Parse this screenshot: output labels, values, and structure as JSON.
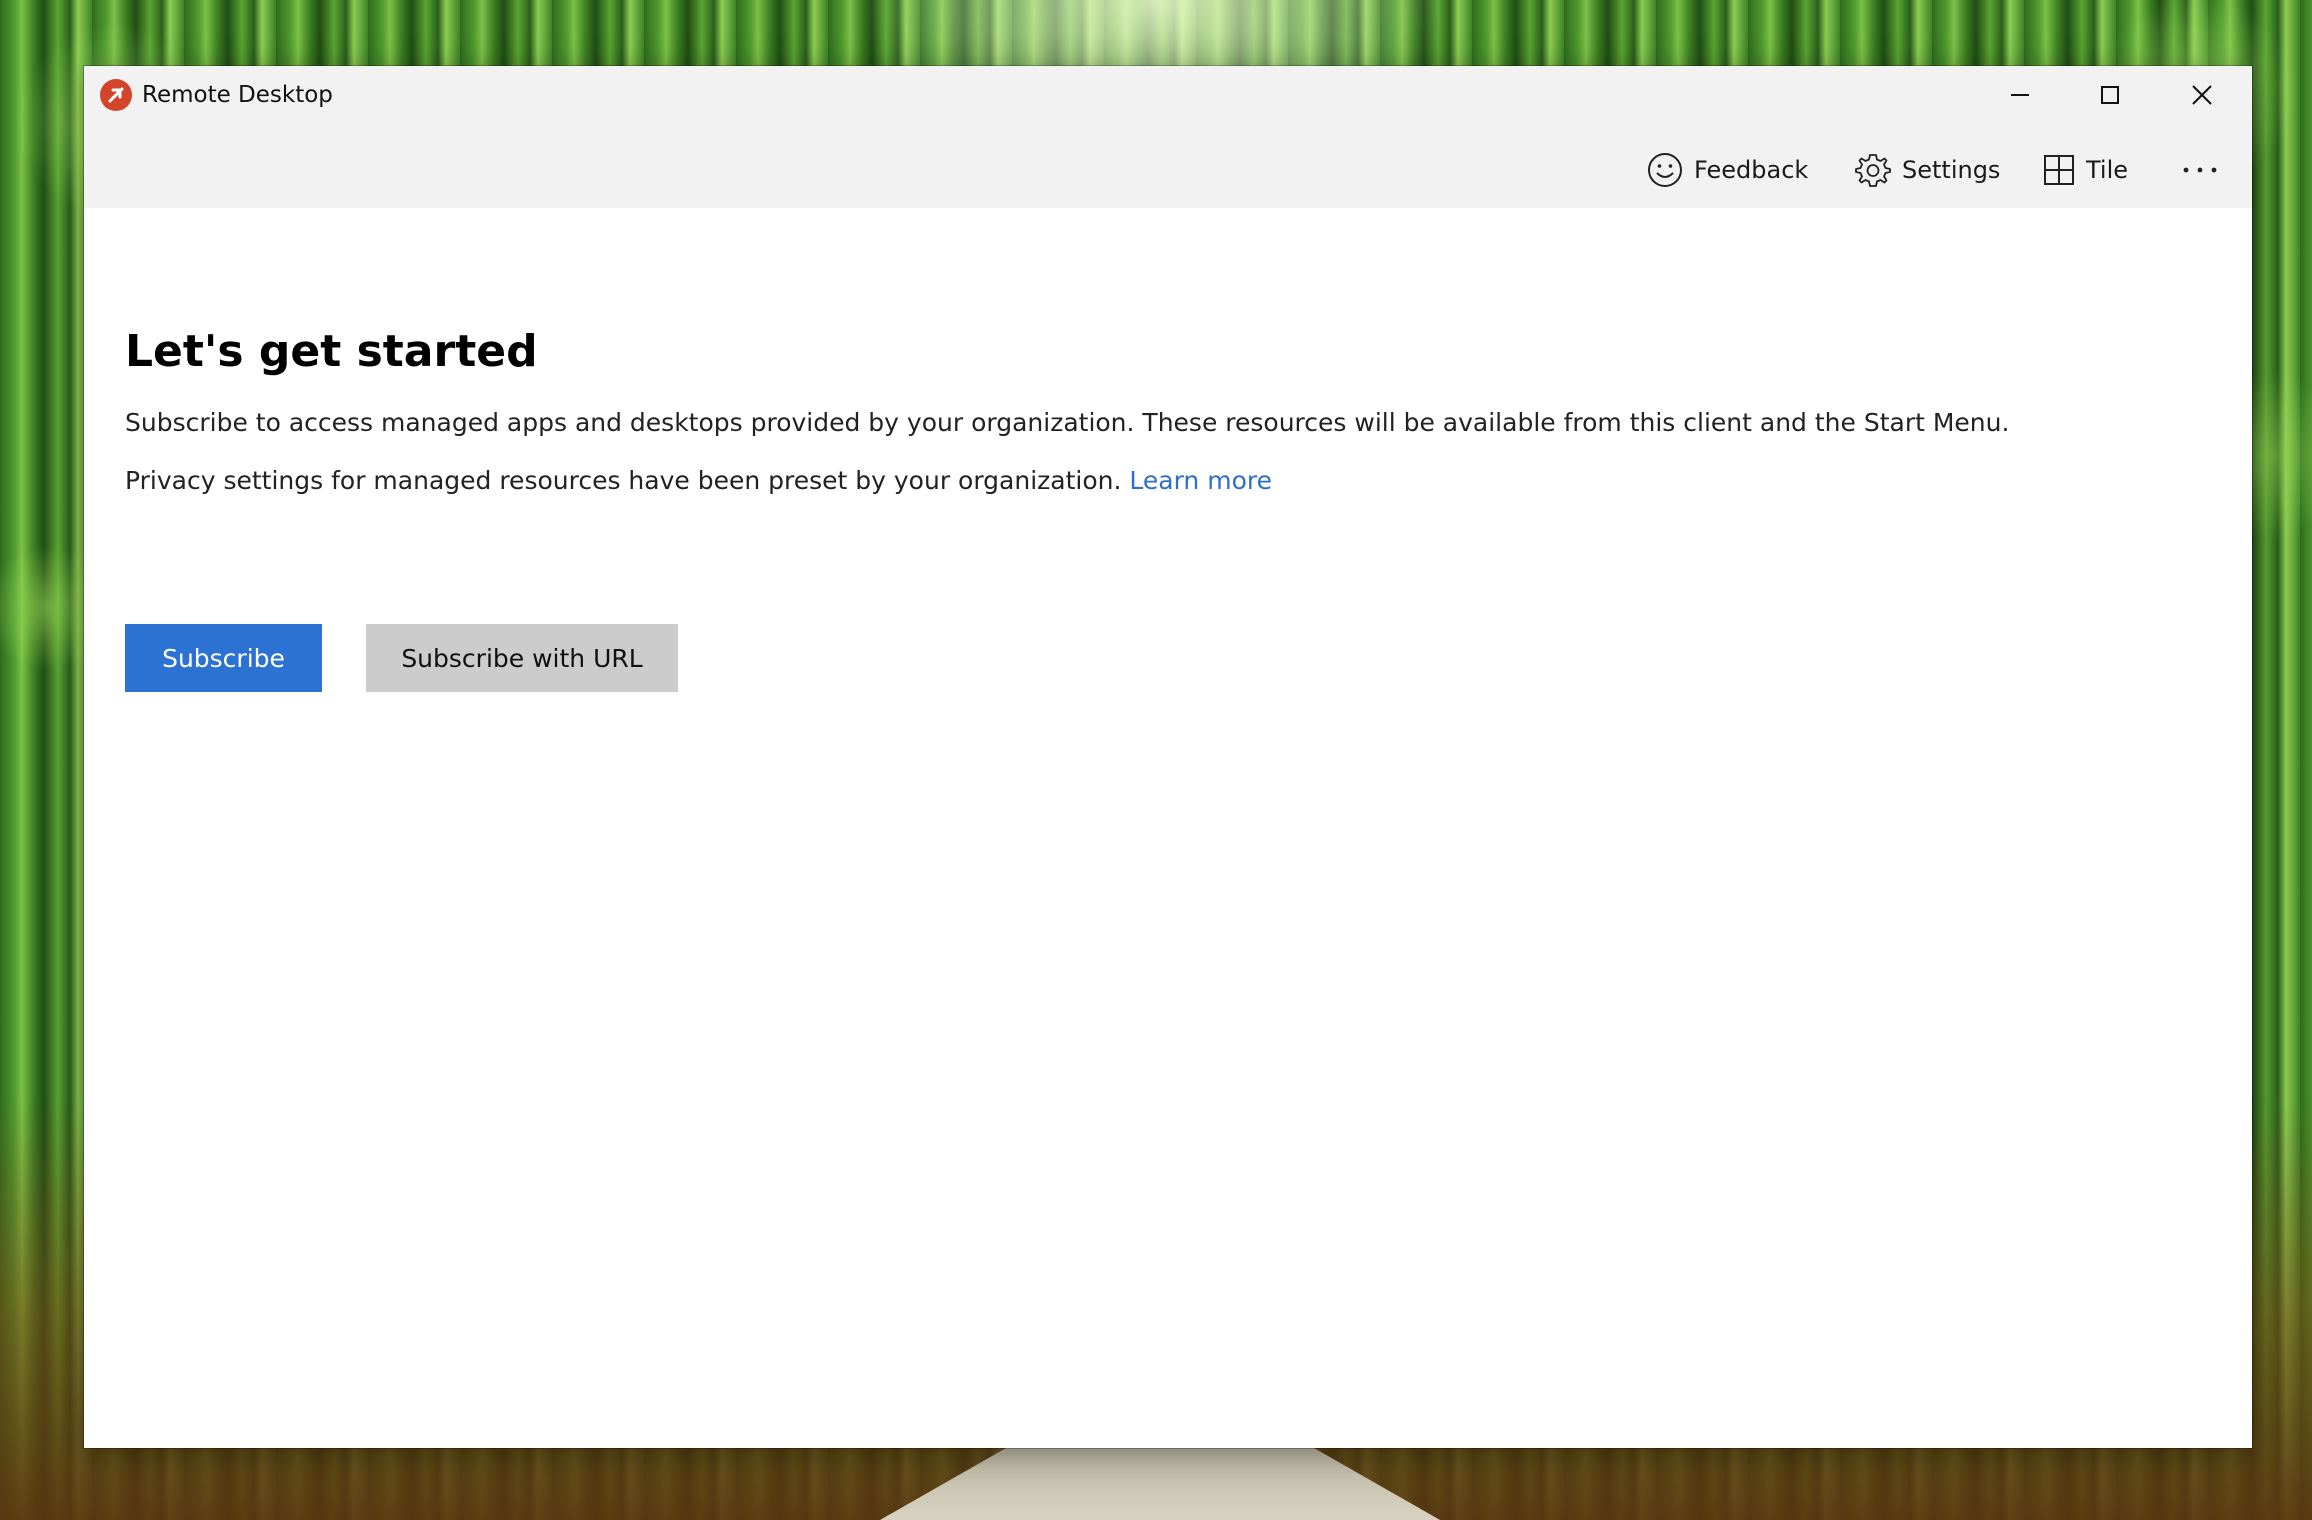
{
  "window": {
    "title": "Remote Desktop",
    "icon": "remote-desktop-icon"
  },
  "caption_buttons": {
    "minimize": "minimize-icon",
    "maximize": "maximize-icon",
    "close": "close-icon"
  },
  "toolbar": {
    "feedback_label": "Feedback",
    "settings_label": "Settings",
    "tile_label": "Tile",
    "more_icon": "more-icon"
  },
  "main": {
    "heading": "Let's get started",
    "description": "Subscribe to access managed apps and desktops provided by your organization. These resources will be available from this client and the Start Menu.",
    "privacy_text": "Privacy settings for managed resources have been preset by your organization.",
    "learn_more": "Learn more",
    "subscribe_label": "Subscribe",
    "subscribe_url_label": "Subscribe with URL"
  },
  "colors": {
    "accent": "#2b72d3",
    "link": "#2e6fc7",
    "app_icon": "#d2452b",
    "secondary_button": "#cccccc",
    "chrome": "#f2f2f2"
  }
}
